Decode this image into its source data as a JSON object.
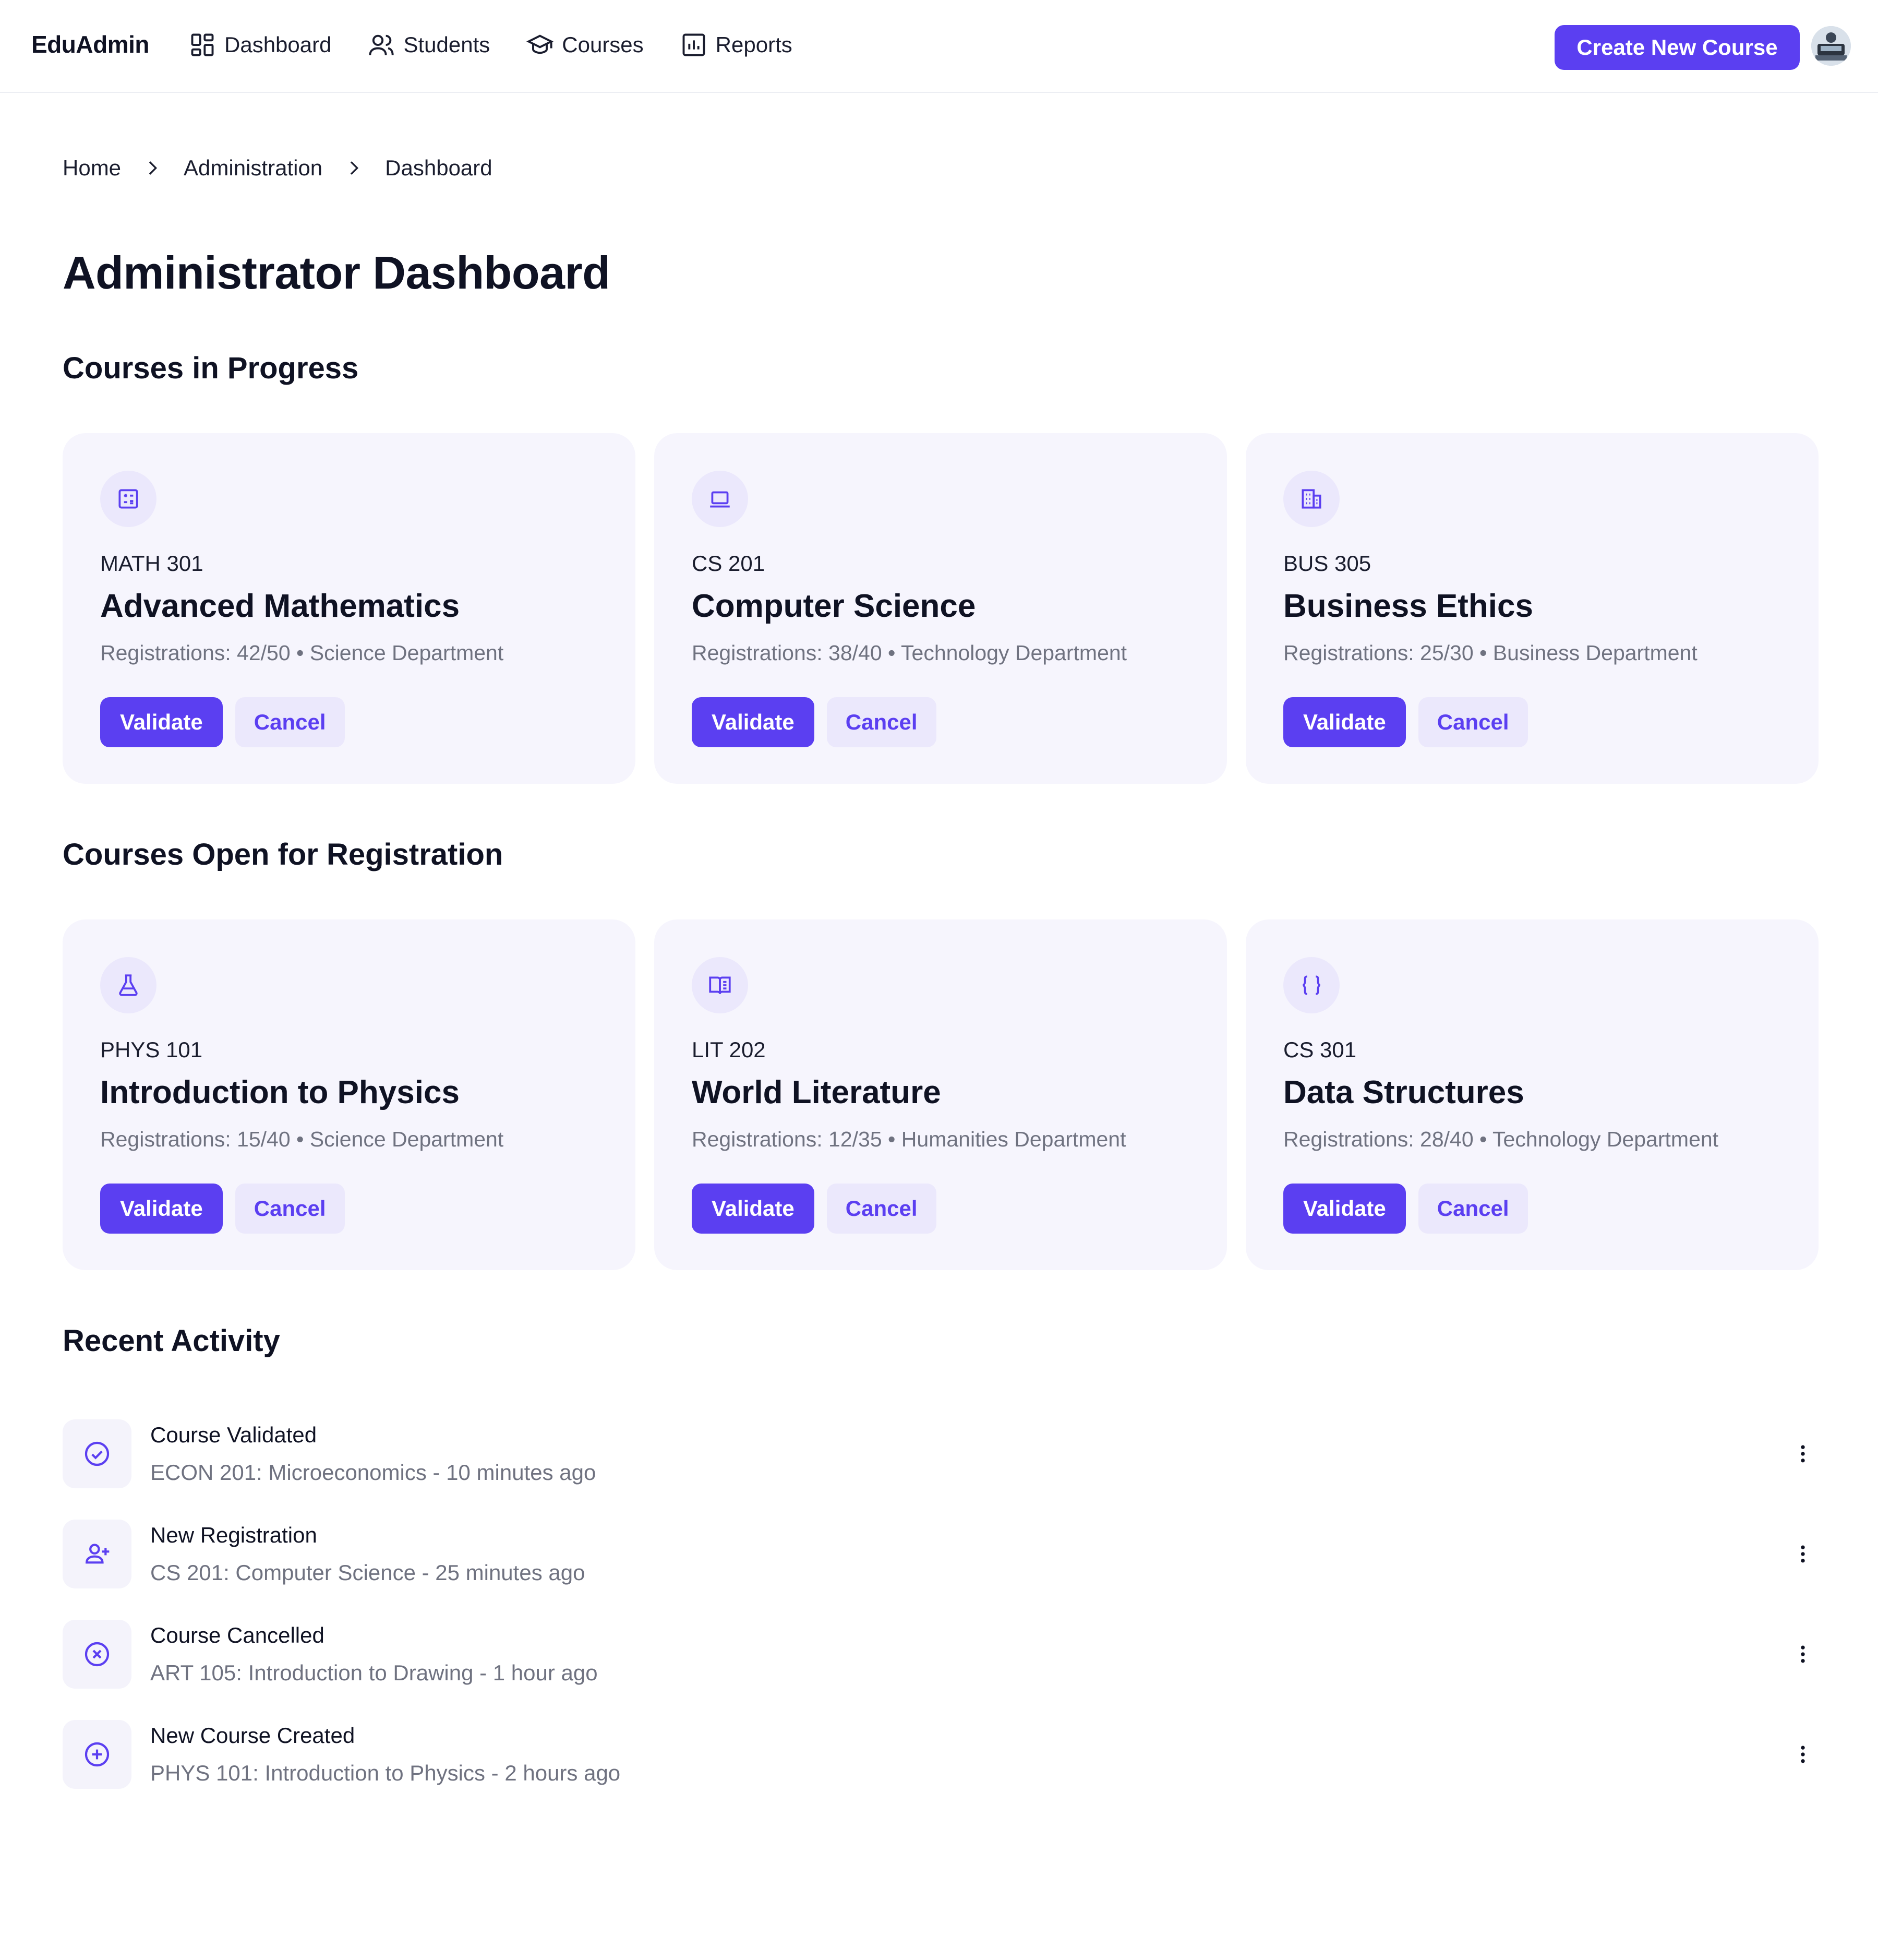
{
  "brand": "EduAdmin",
  "nav": [
    {
      "label": "Dashboard",
      "icon": "dashboard-icon"
    },
    {
      "label": "Students",
      "icon": "users-icon"
    },
    {
      "label": "Courses",
      "icon": "graduation-cap-icon"
    },
    {
      "label": "Reports",
      "icon": "bar-chart-icon"
    }
  ],
  "create_button": "Create New Course",
  "breadcrumb": [
    "Home",
    "Administration",
    "Dashboard"
  ],
  "page_title": "Administrator Dashboard",
  "sections": {
    "in_progress": {
      "title": "Courses in Progress",
      "courses": [
        {
          "code": "MATH 301",
          "title": "Advanced Mathematics",
          "meta": "Registrations: 42/50 • Science Department",
          "icon": "calculator-icon",
          "validate": "Validate",
          "cancel": "Cancel"
        },
        {
          "code": "CS 201",
          "title": "Computer Science",
          "meta": "Registrations: 38/40 • Technology Department",
          "icon": "laptop-icon",
          "validate": "Validate",
          "cancel": "Cancel"
        },
        {
          "code": "BUS 305",
          "title": "Business Ethics",
          "meta": "Registrations: 25/30 • Business Department",
          "icon": "building-icon",
          "validate": "Validate",
          "cancel": "Cancel"
        }
      ]
    },
    "open": {
      "title": "Courses Open for Registration",
      "courses": [
        {
          "code": "PHYS 101",
          "title": "Introduction to Physics",
          "meta": "Registrations: 15/40 • Science Department",
          "icon": "flask-icon",
          "validate": "Validate",
          "cancel": "Cancel"
        },
        {
          "code": "LIT 202",
          "title": "World Literature",
          "meta": "Registrations: 12/35 • Humanities Department",
          "icon": "book-icon",
          "validate": "Validate",
          "cancel": "Cancel"
        },
        {
          "code": "CS 301",
          "title": "Data Structures",
          "meta": "Registrations: 28/40 • Technology Department",
          "icon": "code-braces-icon",
          "validate": "Validate",
          "cancel": "Cancel"
        }
      ]
    },
    "activity": {
      "title": "Recent Activity",
      "items": [
        {
          "title": "Course Validated",
          "detail": "ECON 201: Microeconomics - 10 minutes ago",
          "icon": "check-circle-icon"
        },
        {
          "title": "New Registration",
          "detail": "CS 201: Computer Science - 25 minutes ago",
          "icon": "user-plus-icon"
        },
        {
          "title": "Course Cancelled",
          "detail": "ART 105: Introduction to Drawing - 1 hour ago",
          "icon": "x-circle-icon"
        },
        {
          "title": "New Course Created",
          "detail": "PHYS 101: Introduction to Physics - 2 hours ago",
          "icon": "plus-circle-icon"
        }
      ]
    }
  },
  "colors": {
    "accent": "#5b3ff1",
    "card_bg": "#f6f5fd",
    "muted_text": "#6f7280"
  }
}
